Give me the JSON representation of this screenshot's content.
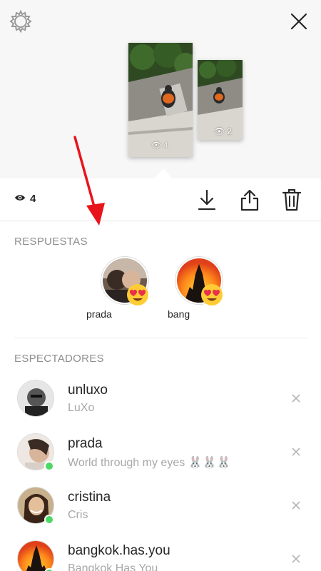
{
  "story": {
    "views_count": "4",
    "thumb1_count": "4",
    "thumb2_count": "2"
  },
  "replies": {
    "title": "RESPUESTAS",
    "items": [
      {
        "name": "prada"
      },
      {
        "name": "bang"
      }
    ]
  },
  "viewers": {
    "title": "ESPECTADORES",
    "items": [
      {
        "username": "unluxo",
        "full_name": "LuXo",
        "online": false
      },
      {
        "username": "prada",
        "full_name": "World through my eyes 🐰🐰🐰",
        "online": true
      },
      {
        "username": "cristina",
        "full_name": "Cris",
        "online": true
      },
      {
        "username": "bangkok.has.you",
        "full_name": "Bangkok Has You",
        "online": true
      }
    ]
  },
  "colors": {
    "online": "#4cd964",
    "arrow": "#e8141c",
    "muted": "#8e8e8e"
  },
  "icons": [
    "gear-icon",
    "close-icon",
    "eye-icon",
    "download-icon",
    "share-icon",
    "trash-icon",
    "dismiss-icon"
  ]
}
